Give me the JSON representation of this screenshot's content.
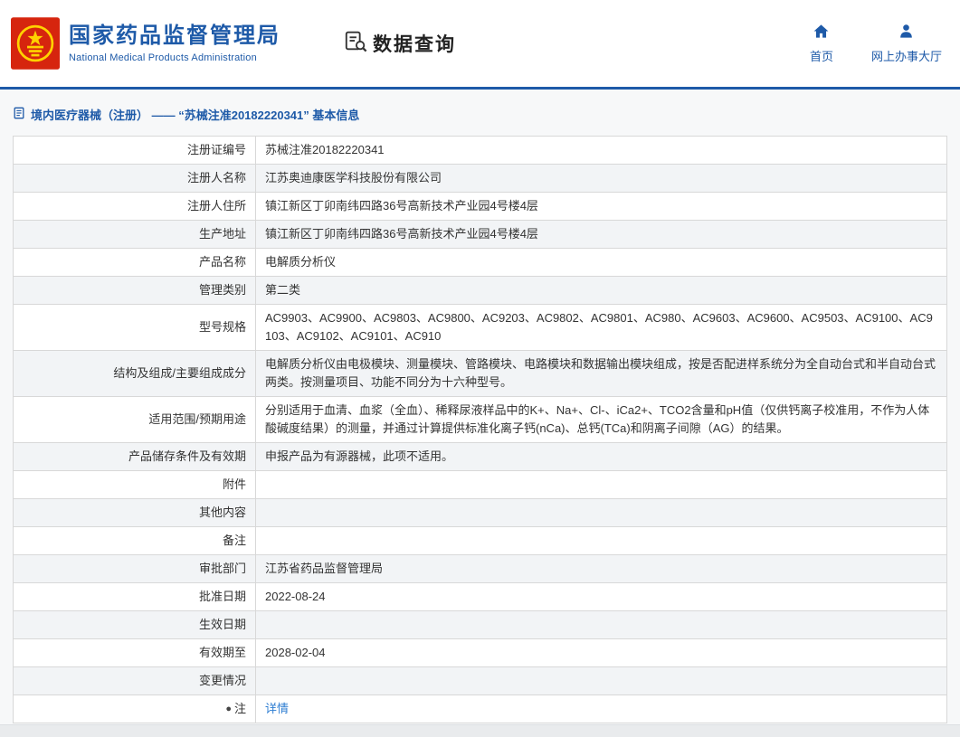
{
  "header": {
    "agency_name_zh": "国家药品监督管理局",
    "agency_name_en": "National Medical Products Administration",
    "query_title": "数据查询",
    "nav_home": "首页",
    "nav_hall": "网上办事大厅"
  },
  "breadcrumb": {
    "text": "境内医疗器械（注册） —— “苏械注准20182220341” 基本信息"
  },
  "colors": {
    "accent_blue": "#1e5aa8",
    "link_blue": "#2d7dd2",
    "alt_row": "#f2f4f6"
  },
  "detail_table": {
    "rows": [
      {
        "label": "注册证编号",
        "value": "苏械注准20182220341"
      },
      {
        "label": "注册人名称",
        "value": "江苏奥迪康医学科技股份有限公司"
      },
      {
        "label": "注册人住所",
        "value": "镇江新区丁卯南纬四路36号高新技术产业园4号楼4层"
      },
      {
        "label": "生产地址",
        "value": "镇江新区丁卯南纬四路36号高新技术产业园4号楼4层"
      },
      {
        "label": "产品名称",
        "value": "电解质分析仪"
      },
      {
        "label": "管理类别",
        "value": "第二类"
      },
      {
        "label": "型号规格",
        "value": "AC9903、AC9900、AC9803、AC9800、AC9203、AC9802、AC9801、AC980、AC9603、AC9600、AC9503、AC9100、AC9103、AC9102、AC9101、AC910"
      },
      {
        "label": "结构及组成/主要组成成分",
        "value": "电解质分析仪由电极模块、测量模块、管路模块、电路模块和数据输出模块组成，按是否配进样系统分为全自动台式和半自动台式两类。按测量项目、功能不同分为十六种型号。"
      },
      {
        "label": "适用范围/预期用途",
        "value": "分别适用于血清、血浆（全血）、稀释尿液样品中的K+、Na+、Cl-、iCa2+、TCO2含量和pH值（仅供钙离子校准用，不作为人体酸碱度结果）的测量，并通过计算提供标准化离子钙(nCa)、总钙(TCa)和阴离子间隙（AG）的结果。"
      },
      {
        "label": "产品储存条件及有效期",
        "value": "申报产品为有源器械，此项不适用。"
      },
      {
        "label": "附件",
        "value": ""
      },
      {
        "label": "其他内容",
        "value": ""
      },
      {
        "label": "备注",
        "value": ""
      },
      {
        "label": "审批部门",
        "value": "江苏省药品监督管理局"
      },
      {
        "label": "批准日期",
        "value": "2022-08-24"
      },
      {
        "label": "生效日期",
        "value": ""
      },
      {
        "label": "有效期至",
        "value": "2028-02-04"
      },
      {
        "label": "变更情况",
        "value": ""
      },
      {
        "label": "注",
        "value": "详情"
      }
    ]
  }
}
